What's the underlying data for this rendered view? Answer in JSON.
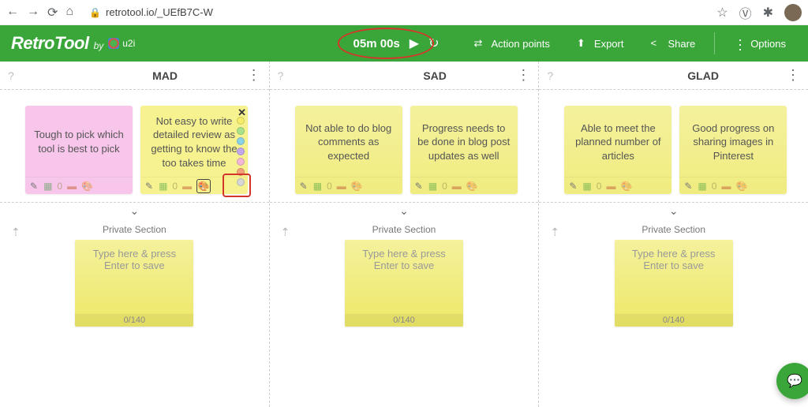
{
  "chrome": {
    "url": "retrotool.io/_UEfB7C-W"
  },
  "brand": {
    "name": "RetroTool",
    "by": "by",
    "partner": "u2i"
  },
  "timer": {
    "value": "05m 00s"
  },
  "actions": {
    "points": "Action points",
    "export": "Export",
    "share": "Share",
    "options": "Options"
  },
  "columns": [
    {
      "title": "MAD",
      "cards": [
        {
          "text": "Tough to pick which tool is best to pick",
          "color": "pink",
          "vote": "0"
        },
        {
          "text": "Not easy to write detailed review as getting to know the too takes time",
          "color": "yellow2",
          "vote": "0",
          "palette": true
        }
      ]
    },
    {
      "title": "SAD",
      "cards": [
        {
          "text": "Not able to do blog comments as expected",
          "color": "yellow",
          "vote": "0"
        },
        {
          "text": "Progress needs to be done in blog post updates as well",
          "color": "yellow",
          "vote": "0"
        }
      ]
    },
    {
      "title": "GLAD",
      "cards": [
        {
          "text": "Able to meet the planned number of articles",
          "color": "yellow",
          "vote": "0"
        },
        {
          "text": "Good progress on sharing images in Pinterest",
          "color": "yellow",
          "vote": "0"
        }
      ]
    }
  ],
  "private": {
    "label": "Private Section",
    "placeholder": "Type here & press Enter to save",
    "count": "0/140"
  },
  "palette_colors": [
    "#f4ec6a",
    "#a8e28a",
    "#8bd1e6",
    "#c3a7ec",
    "#f2b6d7",
    "#f2a27a",
    "#d6d6d6"
  ]
}
